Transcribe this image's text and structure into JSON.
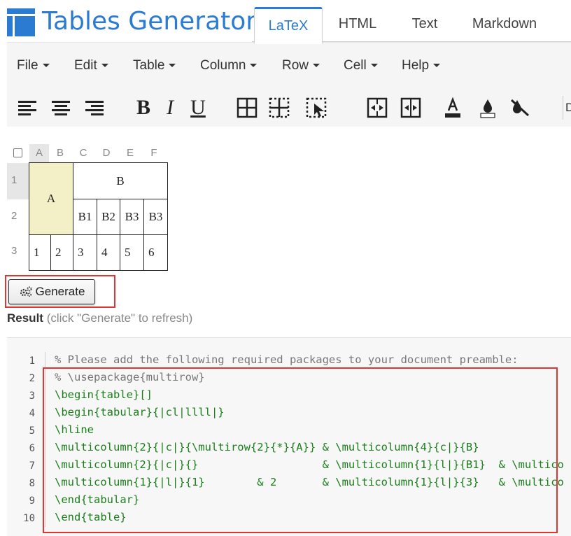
{
  "app": {
    "title": "Tables Generator",
    "tabs": [
      {
        "label": "LaTeX",
        "active": true
      },
      {
        "label": "HTML",
        "active": false
      },
      {
        "label": "Text",
        "active": false
      },
      {
        "label": "Markdown",
        "active": false
      }
    ]
  },
  "menu": {
    "items": [
      "File",
      "Edit",
      "Table",
      "Column",
      "Row",
      "Cell",
      "Help"
    ]
  },
  "toolbar": {
    "icons": [
      "align-left-icon",
      "align-center-icon",
      "align-right-icon",
      "bold-icon",
      "italic-icon",
      "underline-icon",
      "all-borders-icon",
      "inner-borders-icon",
      "select-cells-icon",
      "merge-cells-icon",
      "split-cells-icon",
      "text-color-icon",
      "fill-color-icon",
      "clear-format-icon"
    ],
    "bold_label": "B",
    "italic_label": "I",
    "underline_label": "U",
    "truncated_label": "D"
  },
  "grid": {
    "col_headers": [
      "A",
      "B",
      "C",
      "D",
      "E",
      "F"
    ],
    "row_headers": [
      "1",
      "2",
      "3"
    ],
    "cells": {
      "a": "A",
      "b": "B",
      "b1": "B1",
      "b2": "B2",
      "b3a": "B3",
      "b3b": "B3",
      "r3": [
        "1",
        "2",
        "3",
        "4",
        "5",
        "6"
      ]
    }
  },
  "generate": {
    "label": "Generate"
  },
  "result": {
    "label": "Result",
    "hint": "(click \"Generate\" to refresh)"
  },
  "code": {
    "line_numbers": [
      "1",
      "2",
      "3",
      "4",
      "5",
      "6",
      "7",
      "8",
      "9",
      "10"
    ],
    "lines": [
      "% Please add the following required packages to your document preamble:",
      "% \\usepackage{multirow}",
      "\\begin{table}[]",
      "\\begin{tabular}{|cl|llll|}",
      "\\hline",
      "\\multicolumn{2}{|c|}{\\multirow{2}{*}{A}} & \\multicolumn{4}{c|}{B}",
      "\\multicolumn{2}{|c|}{}                   & \\multicolumn{1}{l|}{B1}  & \\multico",
      "\\multicolumn{1}{|l|}{1}        & 2       & \\multicolumn{1}{l|}{3}   & \\multico",
      "\\end{tabular}",
      "\\end{table}"
    ]
  },
  "colors": {
    "brand": "#2b7bd3",
    "highlight": "#e03535",
    "selected_cell": "#f3efc6"
  }
}
